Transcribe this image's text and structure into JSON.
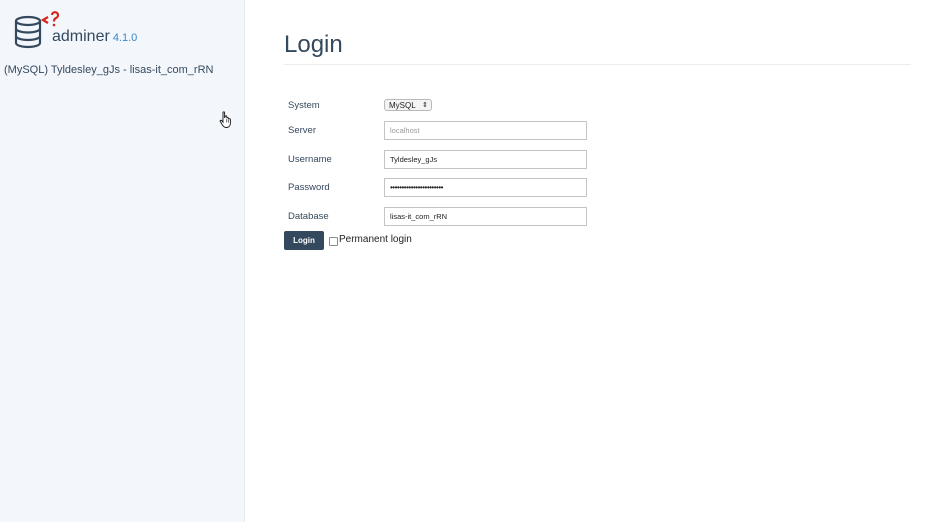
{
  "sidebar": {
    "app_name": "adminer",
    "version": "4.1.0",
    "connection_info": "(MySQL) Tyldesley_gJs - lisas-it_com_rRN"
  },
  "main": {
    "title": "Login",
    "form": {
      "system_label": "System",
      "system_value": "MySQL",
      "server_label": "Server",
      "server_placeholder": "localhost",
      "username_label": "Username",
      "username_value": "Tyldesley_gJs",
      "password_label": "Password",
      "password_mask": "•••••••••••••••••••••••",
      "database_label": "Database",
      "database_value": "lisas-it_com_rRN",
      "login_button": "Login",
      "permanent_login_label": "Permanent login"
    }
  },
  "colors": {
    "accent": "#34495e",
    "version": "#3a86c8",
    "logo_red": "#d9231c",
    "sidebar_bg": "#f3f7fc"
  },
  "icons": {
    "logo": "database-icon",
    "cursor": "hand-cursor-icon"
  }
}
